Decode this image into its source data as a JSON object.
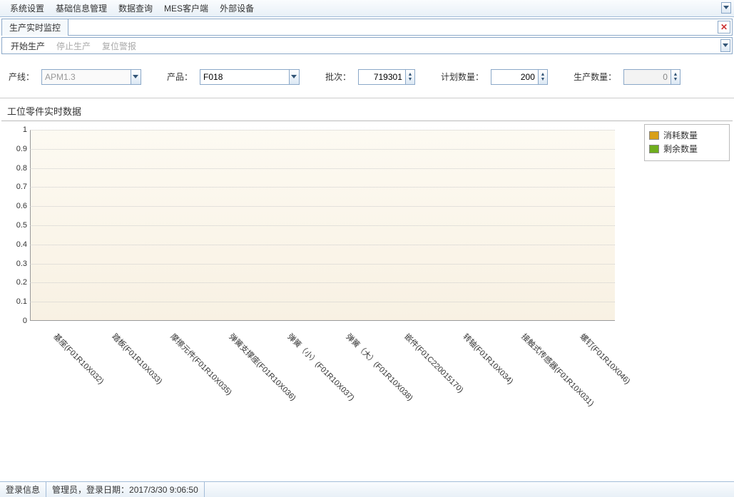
{
  "menu": [
    "系统设置",
    "基础信息管理",
    "数据查询",
    "MES客户端",
    "外部设备"
  ],
  "tab": {
    "label": "生产实时监控"
  },
  "toolbar": {
    "start": "开始生产",
    "stop": "停止生产",
    "reset": "复位警报"
  },
  "filters": {
    "line_label": "产线：",
    "line_value": "APM1.3",
    "product_label": "产品：",
    "product_value": "F018",
    "batch_label": "批次：",
    "batch_value": "719301",
    "plan_label": "计划数量：",
    "plan_value": "200",
    "prod_label": "生产数量：",
    "prod_value": "0"
  },
  "chart_title": "工位零件实时数据",
  "legend": {
    "consumed": {
      "label": "消耗数量",
      "color": "#d8a019"
    },
    "remaining": {
      "label": "剩余数量",
      "color": "#6fae1e"
    }
  },
  "chart_data": {
    "type": "bar",
    "categories": [
      "基座(F01R10X032)",
      "踏板(F01R10X033)",
      "摩擦元件(F01R10X035)",
      "弹簧支撑座(F01R10X036)",
      "弹簧（小）(F01R10X037)",
      "弹簧（大）(F01R10X038)",
      "嵌件(F01C220015170)",
      "转轴(F01R10X034)",
      "接触式传感器(F01R10X031)",
      "螺钉(F01R10X046)"
    ],
    "series": [
      {
        "name": "消耗数量",
        "values": [
          0,
          0,
          0,
          0,
          0,
          0,
          0,
          0,
          0,
          0
        ]
      },
      {
        "name": "剩余数量",
        "values": [
          0,
          0,
          0,
          0,
          0,
          0,
          0,
          0,
          0,
          0
        ]
      }
    ],
    "ylim": [
      0,
      1
    ],
    "yticks": [
      0,
      0.1,
      0.2,
      0.3,
      0.4,
      0.5,
      0.6,
      0.7,
      0.8,
      0.9,
      1
    ],
    "title": "工位零件实时数据",
    "xlabel": "",
    "ylabel": ""
  },
  "status": {
    "login_label": "登录信息",
    "login_text": "管理员，登录日期：2017/3/30 9:06:50"
  }
}
